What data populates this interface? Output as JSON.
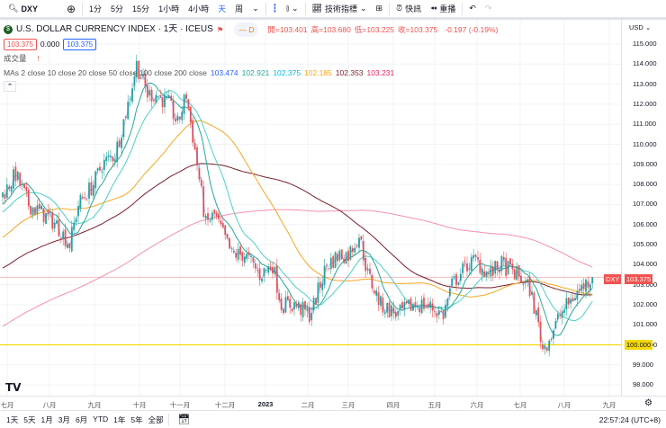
{
  "toolbar": {
    "symbol": "DXY",
    "intervals": [
      "1分",
      "5分",
      "15分",
      "1小時",
      "4小時",
      "天",
      "周"
    ],
    "active_interval": "天",
    "indicators": "技術指標",
    "news": "快訊",
    "replay": "重播"
  },
  "legend": {
    "title": "U.S. DOLLAR CURRENCY INDEX · 1天 · ICEUS",
    "badge": "D",
    "ohlc": [
      {
        "label": "開",
        "value": "103.401"
      },
      {
        "label": "高",
        "value": "103.680"
      },
      {
        "label": "低",
        "value": "103.225"
      },
      {
        "label": "收",
        "value": "103.375"
      }
    ],
    "change": "-0.197 (-0.19%)",
    "bid": "103.375",
    "spread": "0.000",
    "ask": "103.375",
    "volume_label": "成交量",
    "ma_label": "MAs 2 close 10 close 20 close 50 close 100 close 200 close",
    "ma_values": [
      {
        "v": "103.474",
        "c": "#2962ff"
      },
      {
        "v": "102.921",
        "c": "#26a69a"
      },
      {
        "v": "102.375",
        "c": "#00bcd4"
      },
      {
        "v": "102.185",
        "c": "#f6a821"
      },
      {
        "v": "102.353",
        "c": "#7b1e2b"
      },
      {
        "v": "103.231",
        "c": "#e91e63"
      }
    ]
  },
  "price_axis": {
    "currency": "USD",
    "ticks": [
      "115.000",
      "114.000",
      "113.000",
      "112.000",
      "111.000",
      "110.000",
      "109.000",
      "108.000",
      "107.000",
      "106.000",
      "105.000",
      "104.000",
      "103.000",
      "102.000",
      "101.000",
      "100.000",
      "99.000",
      "98.000"
    ],
    "current_symbol": "DXY",
    "current_price": "103.375",
    "line_price": "100.000"
  },
  "time_axis": [
    "七月",
    "八月",
    "九月",
    "十月",
    "十一月",
    "十二月",
    "2023",
    "二月",
    "三月",
    "四月",
    "五月",
    "六月",
    "七月",
    "八月",
    "九月"
  ],
  "bottom": {
    "ranges": [
      "1天",
      "5天",
      "1月",
      "3月",
      "6月",
      "YTD",
      "1年",
      "5年",
      "全部"
    ],
    "clock": "22:57:24 (UTC+8)"
  },
  "colors": {
    "up": "#26a69a",
    "down": "#ef5350",
    "ma2": "#2962ff",
    "ma10": "#26a69a",
    "ma20": "#4dd0c8",
    "ma50": "#f6a821",
    "ma100": "#7b1e2b",
    "ma200": "#f48fb1",
    "hline": "#f5d90a"
  },
  "chart_data": {
    "type": "candlestick",
    "ylim": [
      97.5,
      115.5
    ],
    "day_price_anchors": [
      [
        -200,
        94.5
      ],
      [
        -120,
        100
      ],
      [
        -40,
        104
      ],
      [
        0,
        107.5
      ],
      [
        6,
        108.5
      ],
      [
        12,
        107
      ],
      [
        19,
        106.5
      ],
      [
        25,
        106
      ],
      [
        31,
        105
      ],
      [
        35,
        107
      ],
      [
        42,
        108
      ],
      [
        46,
        109
      ],
      [
        52,
        109.5
      ],
      [
        58,
        112
      ],
      [
        62,
        114
      ],
      [
        67,
        112.5
      ],
      [
        71,
        112.5
      ],
      [
        77,
        112
      ],
      [
        81,
        111
      ],
      [
        85,
        112.5
      ],
      [
        90,
        109
      ],
      [
        94,
        106
      ],
      [
        98,
        106.5
      ],
      [
        102,
        105.5
      ],
      [
        106,
        104.5
      ],
      [
        112,
        104.5
      ],
      [
        119,
        103.5
      ],
      [
        125,
        104
      ],
      [
        129,
        102
      ],
      [
        135,
        102
      ],
      [
        142,
        101.5
      ],
      [
        144,
        102
      ],
      [
        150,
        104
      ],
      [
        156,
        104.5
      ],
      [
        160,
        104.5
      ],
      [
        165,
        105.5
      ],
      [
        169,
        103.5
      ],
      [
        175,
        102
      ],
      [
        183,
        101.5
      ],
      [
        190,
        102
      ],
      [
        196,
        102
      ],
      [
        204,
        101.5
      ],
      [
        208,
        103
      ],
      [
        215,
        104
      ],
      [
        219,
        104.2
      ],
      [
        225,
        103.5
      ],
      [
        231,
        104
      ],
      [
        238,
        103.5
      ],
      [
        244,
        102.8
      ],
      [
        248,
        101
      ],
      [
        250,
        99.8
      ],
      [
        254,
        100.5
      ],
      [
        258,
        101.5
      ],
      [
        265,
        102.5
      ],
      [
        273,
        103.4
      ]
    ]
  }
}
